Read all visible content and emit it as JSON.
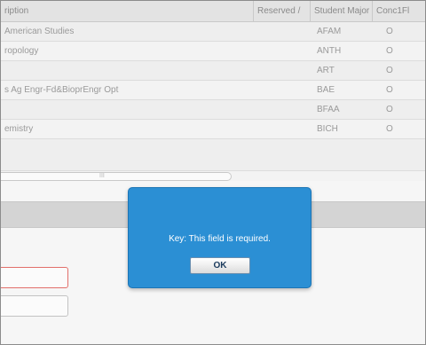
{
  "grid": {
    "columns": [
      "ription",
      "Reserved /",
      "Student Major",
      "Conc1Fl"
    ],
    "rows": [
      [
        "American Studies",
        "",
        "AFAM",
        "O"
      ],
      [
        "ropology",
        "",
        "ANTH",
        "O"
      ],
      [
        "",
        "",
        "ART",
        "O"
      ],
      [
        "s Ag Engr-Fd&BioprEngr Opt",
        "",
        "BAE",
        "O"
      ],
      [
        "",
        "",
        "BFAA",
        "O"
      ],
      [
        "emistry",
        "",
        "BICH",
        "O"
      ]
    ],
    "scroll_grip": "III"
  },
  "modal": {
    "message": "Key: This field is required.",
    "ok_label": "OK"
  }
}
